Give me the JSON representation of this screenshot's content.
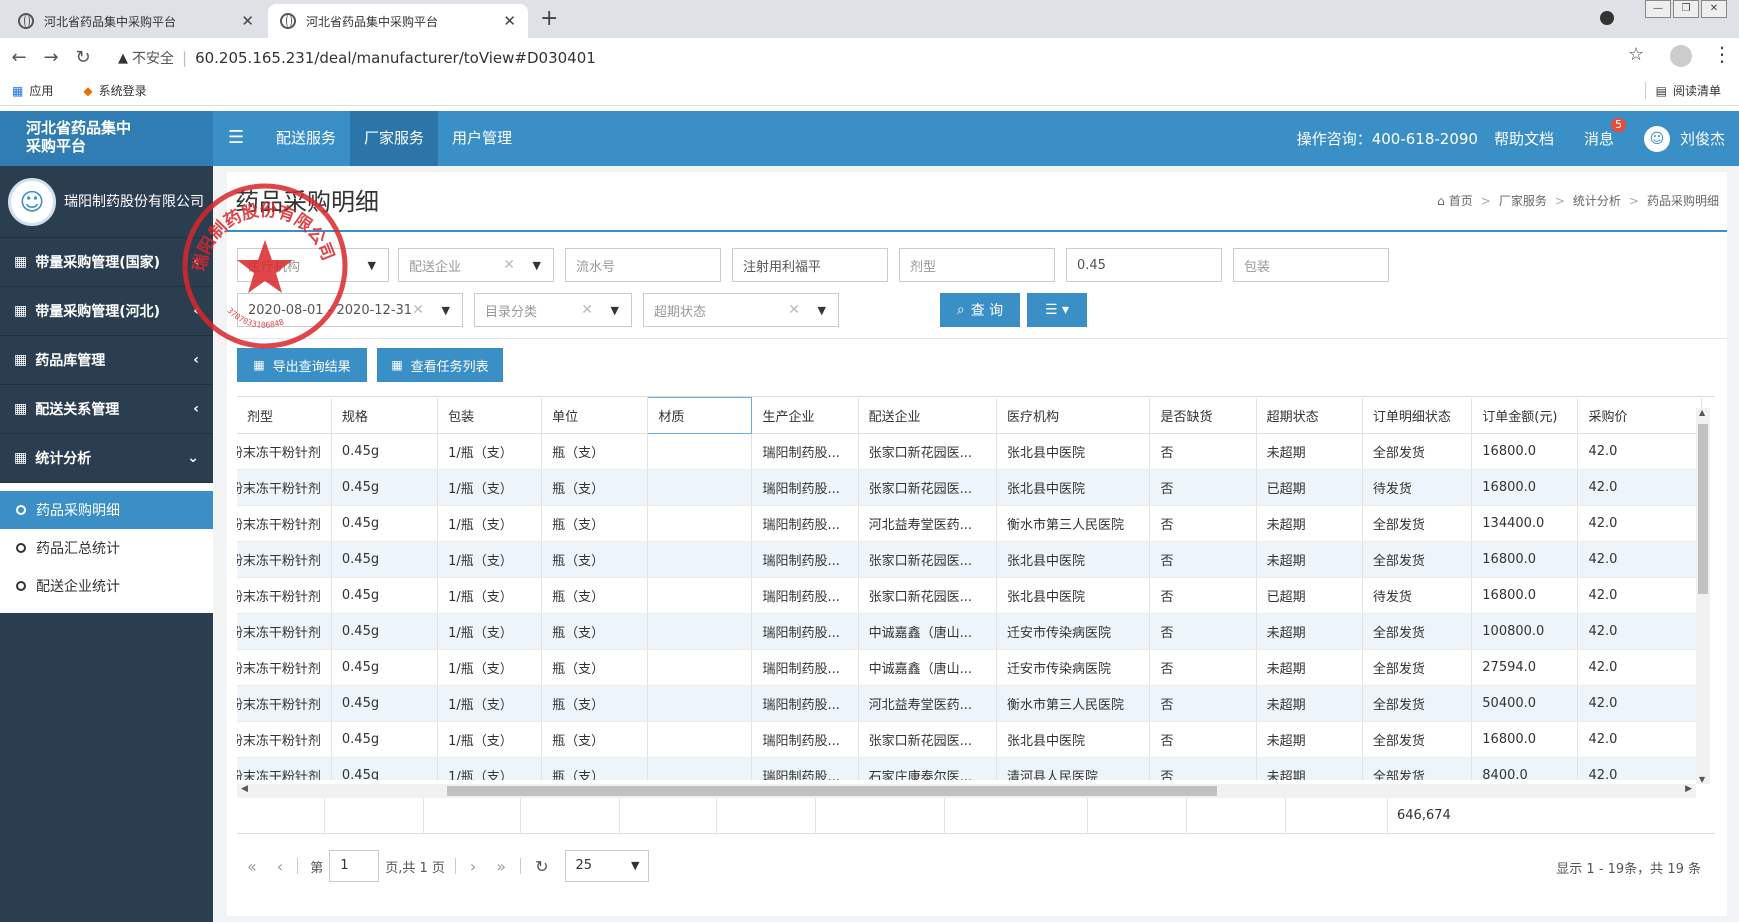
{
  "browser": {
    "tabs": [
      {
        "title": "河北省药品集中采购平台",
        "active": false
      },
      {
        "title": "河北省药品集中采购平台",
        "active": true
      }
    ],
    "new_tab": "+",
    "insecure_label": "不安全",
    "url": "60.205.165.231/deal/manufacturer/toView#D030401",
    "bookmarks": [
      "应用",
      "系统登录"
    ],
    "reading_list": "阅读清单"
  },
  "header": {
    "logo_line1": "河北省药品集中",
    "logo_line2": "采购平台",
    "nav": [
      "配送服务",
      "厂家服务",
      "用户管理"
    ],
    "active_nav": "厂家服务",
    "hotline": "操作咨询：400-618-2090",
    "help": "帮助文档",
    "messages": "消息",
    "message_count": "5",
    "user": "刘俊杰"
  },
  "sidebar": {
    "org_name": "瑞阳制药股份有限公司",
    "menu": [
      {
        "label": "带量采购管理(国家)",
        "chev": "‹"
      },
      {
        "label": "带量采购管理(河北)",
        "chev": "‹"
      },
      {
        "label": "药品库管理",
        "chev": "‹"
      },
      {
        "label": "配送关系管理",
        "chev": "‹"
      },
      {
        "label": "统计分析",
        "chev": "⌄"
      }
    ],
    "submenu": [
      "药品采购明细",
      "药品汇总统计",
      "配送企业统计"
    ]
  },
  "page": {
    "title": "药品采购明细",
    "breadcrumb": [
      "首页",
      "厂家服务",
      "统计分析",
      "药品采购明细"
    ]
  },
  "filters": {
    "medical_org": "医疗机构",
    "delivery_company": "配送企业",
    "serial_no": "流水号",
    "drug_name": "注射用利福平",
    "dosage_form": "剂型",
    "spec": "0.45",
    "packaging": "包装",
    "date_range": "2020-08-01 - 2020-12-31",
    "catalog": "目录分类",
    "overdue_status": "超期状态",
    "query_label": "查 询"
  },
  "actions": {
    "export_label": "导出查询结果",
    "tasks_label": "查看任务列表"
  },
  "table": {
    "columns": [
      "剂型",
      "规格",
      "包装",
      "单位",
      "材质",
      "生产企业",
      "配送企业",
      "医疗机构",
      "是否缺货",
      "超期状态",
      "订单明细状态",
      "订单金额(元)",
      "采购价"
    ],
    "rows": [
      [
        "注射用无菌粉末冻干粉针剂",
        "0.45g",
        "1/瓶（支）",
        "瓶（支）",
        "",
        "瑞阳制药股...",
        "张家口新花园医...",
        "张北县中医院",
        "否",
        "未超期",
        "全部发货",
        "16800.0",
        "42.0"
      ],
      [
        "注射用无菌粉末冻干粉针剂",
        "0.45g",
        "1/瓶（支）",
        "瓶（支）",
        "",
        "瑞阳制药股...",
        "张家口新花园医...",
        "张北县中医院",
        "否",
        "已超期",
        "待发货",
        "16800.0",
        "42.0"
      ],
      [
        "注射用无菌粉末冻干粉针剂",
        "0.45g",
        "1/瓶（支）",
        "瓶（支）",
        "",
        "瑞阳制药股...",
        "河北益寿堂医药...",
        "衡水市第三人民医院",
        "否",
        "未超期",
        "全部发货",
        "134400.0",
        "42.0"
      ],
      [
        "注射用无菌粉末冻干粉针剂",
        "0.45g",
        "1/瓶（支）",
        "瓶（支）",
        "",
        "瑞阳制药股...",
        "张家口新花园医...",
        "张北县中医院",
        "否",
        "未超期",
        "全部发货",
        "16800.0",
        "42.0"
      ],
      [
        "注射用无菌粉末冻干粉针剂",
        "0.45g",
        "1/瓶（支）",
        "瓶（支）",
        "",
        "瑞阳制药股...",
        "张家口新花园医...",
        "张北县中医院",
        "否",
        "已超期",
        "待发货",
        "16800.0",
        "42.0"
      ],
      [
        "注射用无菌粉末冻干粉针剂",
        "0.45g",
        "1/瓶（支）",
        "瓶（支）",
        "",
        "瑞阳制药股...",
        "中诚嘉鑫（唐山...",
        "迁安市传染病医院",
        "否",
        "未超期",
        "全部发货",
        "100800.0",
        "42.0"
      ],
      [
        "注射用无菌粉末冻干粉针剂",
        "0.45g",
        "1/瓶（支）",
        "瓶（支）",
        "",
        "瑞阳制药股...",
        "中诚嘉鑫（唐山...",
        "迁安市传染病医院",
        "否",
        "未超期",
        "全部发货",
        "27594.0",
        "42.0"
      ],
      [
        "注射用无菌粉末冻干粉针剂",
        "0.45g",
        "1/瓶（支）",
        "瓶（支）",
        "",
        "瑞阳制药股...",
        "河北益寿堂医药...",
        "衡水市第三人民医院",
        "否",
        "未超期",
        "全部发货",
        "50400.0",
        "42.0"
      ],
      [
        "注射用无菌粉末冻干粉针剂",
        "0.45g",
        "1/瓶（支）",
        "瓶（支）",
        "",
        "瑞阳制药股...",
        "张家口新花园医...",
        "张北县中医院",
        "否",
        "未超期",
        "全部发货",
        "16800.0",
        "42.0"
      ],
      [
        "注射用无菌粉末冻干粉针剂",
        "0.45g",
        "1/瓶（支）",
        "瓶（支）",
        "",
        "瑞阳制药股...",
        "石家庄康泰尔医...",
        "清河县人民医院",
        "否",
        "未超期",
        "全部发货",
        "8400.0",
        "42.0"
      ]
    ],
    "total_amount": "646,674"
  },
  "pager": {
    "first": "«",
    "prev": "‹",
    "page_prefix": "第",
    "page_value": "1",
    "page_suffix": "页,共 1 页",
    "next": "›",
    "last": "»",
    "refresh": "↻",
    "page_size": "25",
    "summary": "显示 1 - 19条，共 19 条"
  },
  "stamp": {
    "text": "瑞阳制药股份有限公司",
    "code": "3707033106848"
  },
  "colors": {
    "primary": "#3a8fc6",
    "sidebar": "#2b3e50",
    "stamp": "#d9262b",
    "row_alt": "#edf5fb"
  }
}
